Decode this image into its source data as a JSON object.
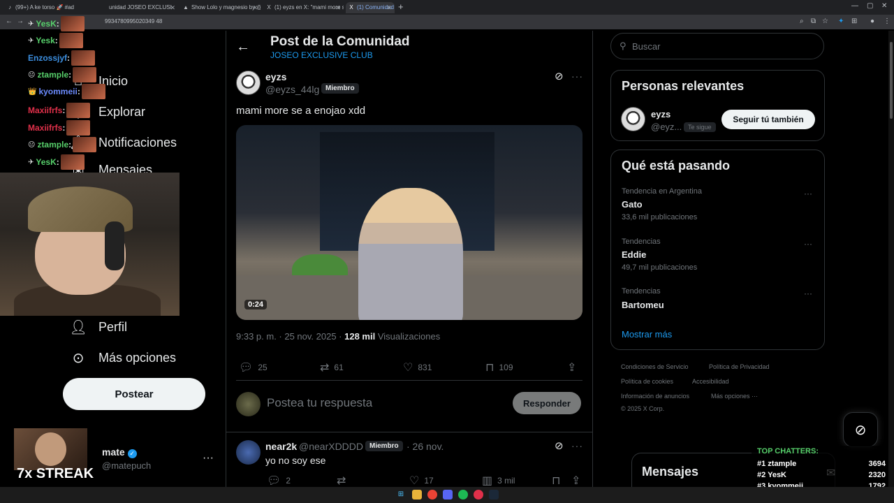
{
  "browser": {
    "tabs": [
      {
        "label": "(99+) A ke torso 🚀 #ad"
      },
      {
        "label": "unidad JOSEO EXCLUSI"
      },
      {
        "label": "Show Lolo y magnesio by @R"
      },
      {
        "label": "(1) eyzs en X: \"mami more se a"
      },
      {
        "label": "(1) Comunidad"
      }
    ],
    "url": "9934780995020349 48"
  },
  "nav": {
    "items": [
      {
        "label": "Inicio"
      },
      {
        "label": "Explorar"
      },
      {
        "label": "Notificaciones"
      },
      {
        "label": "Mensajes"
      },
      {
        "label": "Perfil"
      },
      {
        "label": "Más opciones"
      }
    ],
    "post_button": "Postear",
    "profile": {
      "name": "mate",
      "handle": "@matepuch",
      "streak": "7x STREAK"
    }
  },
  "chat_overlay": [
    {
      "user": "YesK",
      "color": "#57d06b"
    },
    {
      "user": "Yesk",
      "color": "#57d06b"
    },
    {
      "user": "Enzossjyf",
      "color": "#3c8fe0"
    },
    {
      "user": "ztample",
      "color": "#57d06b"
    },
    {
      "user": "kyommeii",
      "color": "#6c8cff"
    },
    {
      "user": "Maxiifrfs",
      "color": "#e0304a"
    },
    {
      "user": "Maxiifrfs",
      "color": "#e0304a"
    },
    {
      "user": "ztample",
      "color": "#57d06b"
    },
    {
      "user": "YesK",
      "color": "#57d06b"
    }
  ],
  "header": {
    "title": "Post de la Comunidad",
    "subtitle": "JOSEO EXCLUSIVE CLUB"
  },
  "post": {
    "name": "eyzs",
    "handle": "@eyzs_44lg",
    "badge": "Miembro",
    "text": "mami more se a enojao xdd",
    "duration": "0:24",
    "time": "9:33 p. m. · 25 nov. 2025 · ",
    "views": "128 mil",
    "views_label": " Visualizaciones",
    "stats": {
      "replies": "25",
      "reposts": "61",
      "likes": "831",
      "bookmarks": "109"
    }
  },
  "reply_box": {
    "placeholder": "Postea tu respuesta",
    "button": "Responder"
  },
  "reply": {
    "name": "near2k",
    "handle": "@nearXDDDD",
    "badge": "Miembro",
    "date": "· 26 nov.",
    "text": "yo no soy ese",
    "stats": {
      "replies": "2",
      "likes": "17",
      "views": "3 mil"
    }
  },
  "search": {
    "placeholder": "Buscar"
  },
  "relevant": {
    "title": "Personas relevantes",
    "name": "eyzs",
    "handle": "@eyz...",
    "follows_you": "Te sigue",
    "follow_button": "Seguir tú también"
  },
  "trends": {
    "title": "Qué está pasando",
    "items": [
      {
        "category": "Tendencia en Argentina",
        "name": "Gato",
        "count": "33,6 mil publicaciones"
      },
      {
        "category": "Tendencias",
        "name": "Eddie",
        "count": "49,7 mil publicaciones"
      },
      {
        "category": "Tendencias",
        "name": "Bartomeu",
        "count": ""
      }
    ],
    "show_more": "Mostrar más"
  },
  "footer": {
    "links": [
      "Condiciones de Servicio",
      "Política de Privacidad",
      "Política de cookies",
      "Accesibilidad",
      "Información de anuncios",
      "Más opciones ···"
    ],
    "copyright": "© 2025 X Corp."
  },
  "messages": {
    "title": "Mensajes"
  },
  "top_chatters": {
    "title": "TOP CHATTERS:",
    "rows": [
      {
        "rank": "#1 ztample",
        "count": "3694"
      },
      {
        "rank": "#2 YesK",
        "count": "2320"
      },
      {
        "rank": "#3 kyommeii",
        "count": "1792"
      }
    ]
  }
}
